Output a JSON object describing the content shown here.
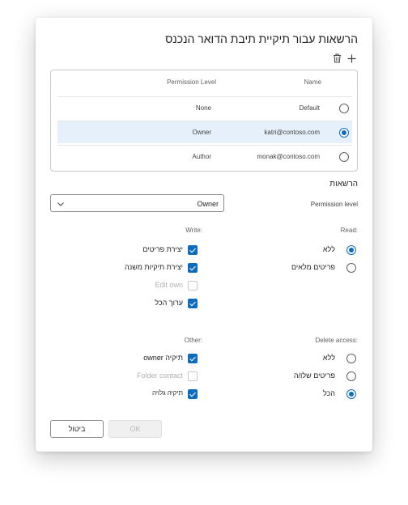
{
  "dialog": {
    "title": "הרשאות עבור תיקיית תיבת הדואר הנכנס"
  },
  "toolbar": {
    "add_icon": "plus-icon",
    "delete_icon": "trash-icon"
  },
  "permissions_table": {
    "headers": {
      "name": "Name",
      "permission_level": "Permission Level"
    },
    "rows": [
      {
        "name": "Default",
        "level": "None",
        "selected": false
      },
      {
        "name": "katri@contoso.com",
        "level": "Owner",
        "selected": true
      },
      {
        "name": "monak@contoso.com",
        "level": "Author",
        "selected": false
      }
    ]
  },
  "permissions": {
    "section_title": "הרשאות",
    "level_label": "Permission level",
    "level_value": "Owner",
    "read": {
      "label": "Read:",
      "options": [
        {
          "label": "ללא",
          "checked": true
        },
        {
          "label": "פריטים מלאים",
          "checked": false
        }
      ]
    },
    "write": {
      "label": "Write:",
      "options": [
        {
          "label": "יצירת פריטים",
          "checked": true,
          "disabled": false
        },
        {
          "label": "יצירת תיקיות משנה",
          "checked": true,
          "disabled": false
        },
        {
          "label": "Edit own",
          "checked": false,
          "disabled": true
        },
        {
          "label": "ערוך הכל",
          "checked": true,
          "disabled": false
        }
      ]
    },
    "delete": {
      "label": "Delete access:",
      "options": [
        {
          "label": "ללא",
          "checked": false
        },
        {
          "label": "פריטים שלו/ה",
          "checked": false
        },
        {
          "label": "הכל",
          "checked": true
        }
      ]
    },
    "other": {
      "label": "Other:",
      "options": [
        {
          "label": "תיקיה owner",
          "checked": true,
          "disabled": false
        },
        {
          "label": "Folder contact",
          "checked": false,
          "disabled": true
        },
        {
          "label": "תיקיה גלויה",
          "checked": true,
          "disabled": false
        }
      ]
    }
  },
  "buttons": {
    "ok": "OK",
    "cancel": "ביטול"
  },
  "colors": {
    "accent": "#0f6cbd",
    "selected_row": "#e6f0fb"
  }
}
